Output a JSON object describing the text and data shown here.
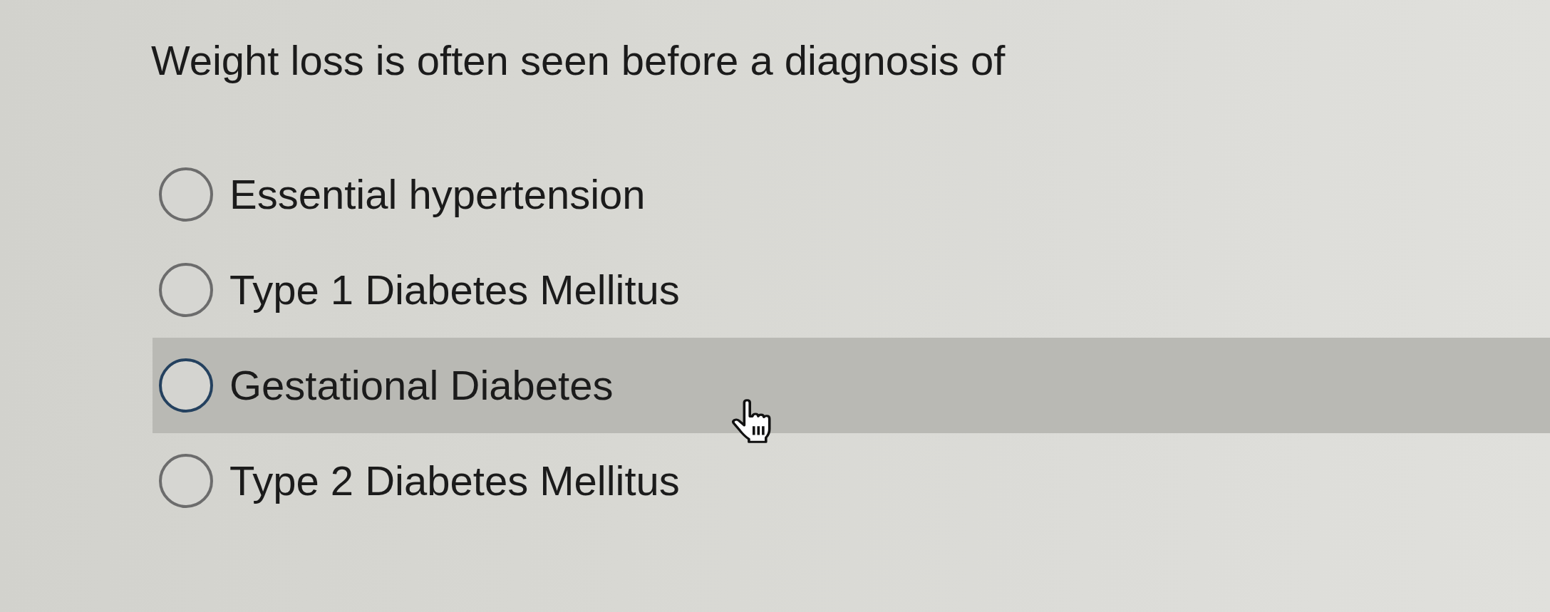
{
  "question": {
    "text": "Weight loss is often seen before a diagnosis of"
  },
  "options": [
    {
      "label": "Essential hypertension",
      "selected": false,
      "hovered": false
    },
    {
      "label": "Type 1 Diabetes Mellitus",
      "selected": false,
      "hovered": false
    },
    {
      "label": "Gestational Diabetes",
      "selected": false,
      "hovered": true
    },
    {
      "label": "Type 2 Diabetes Mellitus",
      "selected": false,
      "hovered": false
    }
  ]
}
